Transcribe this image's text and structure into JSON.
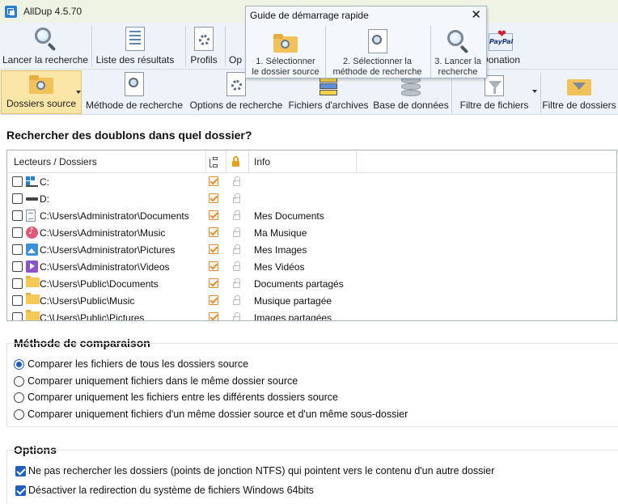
{
  "window": {
    "title": "AllDup 4.5.70"
  },
  "toolbar1": {
    "start_search": "Lancer la recherche",
    "results_list": "Liste des résultats",
    "profiles": "Profils",
    "options_partial": "Op",
    "donation": "Donation",
    "paypal_text": "PayPal"
  },
  "quickstart": {
    "title": "Guide de démarrage rapide",
    "steps": [
      {
        "line1": "1. Sélectionner",
        "line2": "le dossier source"
      },
      {
        "line1": "2. Sélectionner la",
        "line2": "méthode de recherche"
      },
      {
        "line1": "3. Lancer la",
        "line2": "recherche"
      }
    ]
  },
  "toolbar2": {
    "source_folders": "Dossiers source",
    "search_method": "Méthode de recherche",
    "search_options": "Options de recherche",
    "archive_files": "Fichiers d'archives",
    "database": "Base de données",
    "file_filter": "Filtre de fichiers",
    "folder_filter": "Filtre de dossiers"
  },
  "main": {
    "question": "Rechercher des doublons dans quel dossier?",
    "columns": {
      "folders": "Lecteurs / Dossiers",
      "info": "Info"
    },
    "rows": [
      {
        "path": "C:",
        "info": "",
        "icon": "drive-c-icon"
      },
      {
        "path": "D:",
        "info": "",
        "icon": "drive-d-icon"
      },
      {
        "path": "C:\\Users\\Administrator\\Documents",
        "info": "Mes Documents",
        "icon": "documents-icon"
      },
      {
        "path": "C:\\Users\\Administrator\\Music",
        "info": "Ma Musique",
        "icon": "music-icon"
      },
      {
        "path": "C:\\Users\\Administrator\\Pictures",
        "info": "Mes Images",
        "icon": "pictures-icon"
      },
      {
        "path": "C:\\Users\\Administrator\\Videos",
        "info": "Mes Vidéos",
        "icon": "videos-icon"
      },
      {
        "path": "C:\\Users\\Public\\Documents",
        "info": "Documents partagés",
        "icon": "folder-icon"
      },
      {
        "path": "C:\\Users\\Public\\Music",
        "info": "Musique partagée",
        "icon": "folder-icon"
      },
      {
        "path": "C:\\Users\\Public\\Pictures",
        "info": "Images partagées",
        "icon": "folder-icon"
      }
    ]
  },
  "comparison": {
    "title": "Méthode de comparaison",
    "options": [
      "Comparer les fichiers de tous les dossiers source",
      "Comparer uniquement fichiers dans le même dossier source",
      "Comparer uniquement les fichiers entre les différents dossiers source",
      "Comparer uniquement fichiers d'un même dossier source et d'un même sous-dossier"
    ],
    "selected_index": 0
  },
  "options": {
    "title": "Options",
    "items": [
      {
        "label": "Ne pas rechercher les dossiers (points de jonction NTFS) qui pointent vers le contenu d'un autre dossier",
        "checked": true
      },
      {
        "label": "Désactiver la redirection du système de fichiers Windows 64bits",
        "checked": true
      }
    ]
  },
  "colors": {
    "accent": "#1f5fbf",
    "active_tab": "#fbe6a8",
    "toolbar_bg": "#eef3f9"
  }
}
